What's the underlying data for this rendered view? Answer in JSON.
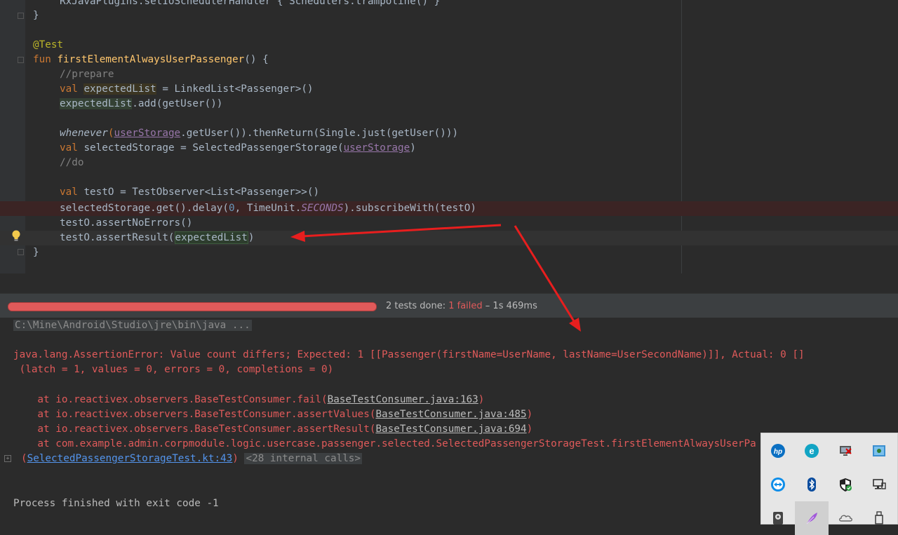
{
  "editor": {
    "lines": [
      {
        "id": "l0",
        "text": "RxJavaPlugins.setIoSchedulerHandler { Schedulers.trampoline() }"
      },
      {
        "id": "l1",
        "text": "}"
      },
      {
        "id": "l2",
        "text": "@Test"
      },
      {
        "id": "l3_kw",
        "text": "fun "
      },
      {
        "id": "l3_fn",
        "text": "firstElementAlwaysUserPassenger"
      },
      {
        "id": "l3_rest",
        "text": "() {"
      },
      {
        "id": "l4",
        "text": "//prepare"
      },
      {
        "id": "l5_kw",
        "text": "val "
      },
      {
        "id": "l5_var",
        "text": "expectedList"
      },
      {
        "id": "l5_rest",
        "text": " = LinkedList<Passenger>()"
      },
      {
        "id": "l6_var",
        "text": "expectedList"
      },
      {
        "id": "l6_rest",
        "text": ".add(getUser())"
      },
      {
        "id": "l7_fn",
        "text": "whenever"
      },
      {
        "id": "l7_a",
        "text": "("
      },
      {
        "id": "l7_prop",
        "text": "userStorage"
      },
      {
        "id": "l7_rest",
        "text": ".getUser()).thenReturn(Single.just(getUser()))"
      },
      {
        "id": "l8_kw",
        "text": "val "
      },
      {
        "id": "l8_rest",
        "text": "selectedStorage = SelectedPassengerStorage("
      },
      {
        "id": "l8_prop",
        "text": "userStorage"
      },
      {
        "id": "l8_end",
        "text": ")"
      },
      {
        "id": "l9",
        "text": "//do"
      },
      {
        "id": "l10_kw",
        "text": "val "
      },
      {
        "id": "l10_rest",
        "text": "testO = TestObserver<List<Passenger>>()"
      },
      {
        "id": "l11_a",
        "text": "selectedStorage.get().delay("
      },
      {
        "id": "l11_num",
        "text": "0"
      },
      {
        "id": "l11_b",
        "text": ", TimeUnit."
      },
      {
        "id": "l11_static",
        "text": "SECONDS"
      },
      {
        "id": "l11_c",
        "text": ").subscribeWith(testO)"
      },
      {
        "id": "l12",
        "text": "testO.assertNoErrors()"
      },
      {
        "id": "l13_a",
        "text": "testO.assertResult("
      },
      {
        "id": "l13_var",
        "text": "expectedList"
      },
      {
        "id": "l13_b",
        "text": ")"
      },
      {
        "id": "l14",
        "text": "}"
      }
    ]
  },
  "test_bar": {
    "progress_fraction": 1.0,
    "progress_color": "#e05a5a",
    "summary_prefix": "2 tests done: ",
    "failed": "1 failed",
    "time": " – 1s 469ms"
  },
  "console": {
    "cmd": "C:\\Mine\\Android\\Studio\\jre\\bin\\java ...",
    "error_line1": "java.lang.AssertionError: Value count differs; Expected: 1 [[Passenger(firstName=UserName, lastName=UserSecondName)]], Actual: 0 [] (latch = 1, values = 0, errors = 0, completions = 0)",
    "error_line1_a": "java.lang.AssertionError: Value count differs; Expected: 1 [[Passenger(firstName=UserName, lastName=UserSecondName)]], Actual: 0 []",
    "error_line2": " (latch = 1, values = 0, errors = 0, completions = 0)",
    "stack": [
      {
        "prefix": "    at io.reactivex.observers.BaseTestConsumer.fail(",
        "link": "BaseTestConsumer.java:163",
        "suffix": ")"
      },
      {
        "prefix": "    at io.reactivex.observers.BaseTestConsumer.assertValues(",
        "link": "BaseTestConsumer.java:485",
        "suffix": ")"
      },
      {
        "prefix": "    at io.reactivex.observers.BaseTestConsumer.assertResult(",
        "link": "BaseTestConsumer.java:694",
        "suffix": ")"
      },
      {
        "prefix": "    at com.example.admin.corpmodule.logic.usercase.passenger.selected.SelectedPassengerStorageTest.firstElementAlwaysUserPassenger",
        "link": "",
        "suffix": ""
      }
    ],
    "frame_open": "(",
    "frame_link": "SelectedPassengerStorageTest.kt:43",
    "frame_close": ")",
    "internal_calls": "<28 internal calls>",
    "exit": "Process finished with exit code -1"
  },
  "tray": {
    "icons": [
      "hp-icon",
      "edge-icon",
      "network-error-icon",
      "network-settings-icon",
      "teamviewer-icon",
      "bluetooth-icon",
      "windows-security-icon",
      "display-icon",
      "hdd-icon",
      "feather-icon",
      "onedrive-icon",
      "usb-icon"
    ]
  },
  "colors": {
    "editor_bg": "#2b2b2b",
    "error_red": "#e05a5a",
    "arrow_red": "#e81e1e"
  }
}
